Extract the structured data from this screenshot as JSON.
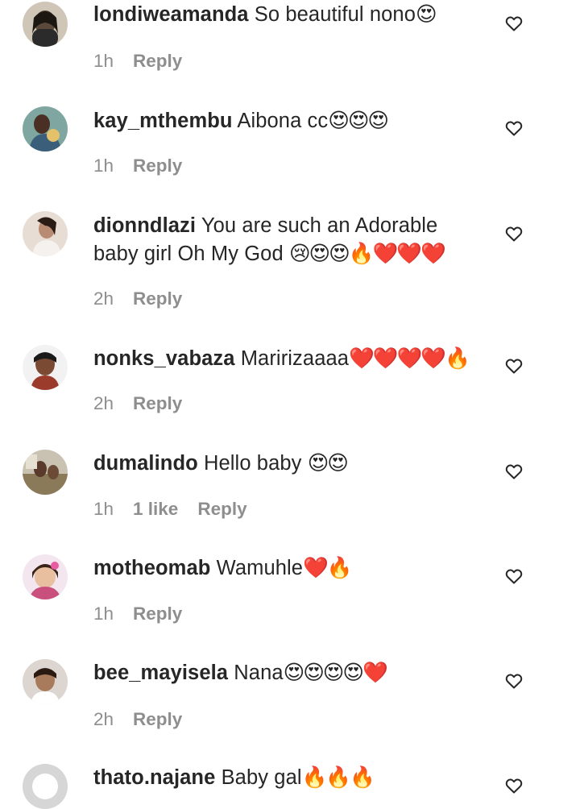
{
  "comments": [
    {
      "username": "londiweamanda",
      "text": "So beautiful nono",
      "emoji": "😍",
      "time": "1h",
      "likes": "",
      "reply": "Reply",
      "avatar_color": "#5b4a3c"
    },
    {
      "username": "kay_mthembu",
      "text": "Aibona cc",
      "emoji": "😍😍😍",
      "time": "1h",
      "likes": "",
      "reply": "Reply",
      "avatar_color": "#3b5f7a"
    },
    {
      "username": "dionndlazi",
      "text": "You are such an Adorable baby girl Oh My God",
      "emoji": "😢😍😍🔥❤️❤️❤️",
      "time": "2h",
      "likes": "",
      "reply": "Reply",
      "avatar_color": "#b88b72"
    },
    {
      "username": "nonks_vabaza",
      "text": "Maririzaaaa",
      "emoji": "❤️❤️❤️❤️🔥",
      "time": "2h",
      "likes": "",
      "reply": "Reply",
      "avatar_color": "#9b3b2c"
    },
    {
      "username": "dumalindo",
      "text": "Hello baby",
      "emoji": "😍😍",
      "time": "1h",
      "likes": "1 like",
      "reply": "Reply",
      "avatar_color": "#8a7a5a"
    },
    {
      "username": "motheomab",
      "text": "Wamuhle",
      "emoji": "❤️🔥",
      "time": "1h",
      "likes": "",
      "reply": "Reply",
      "avatar_color": "#c94f7c"
    },
    {
      "username": "bee_mayisela",
      "text": "Nana",
      "emoji": "😍😍😍😍❤️",
      "time": "2h",
      "likes": "",
      "reply": "Reply",
      "avatar_color": "#a77b5c"
    },
    {
      "username": "thato.najane",
      "text": "Baby gal",
      "emoji": "🔥🔥🔥",
      "time": "",
      "likes": "",
      "reply": "",
      "avatar_color": "#d6d6d6"
    }
  ]
}
